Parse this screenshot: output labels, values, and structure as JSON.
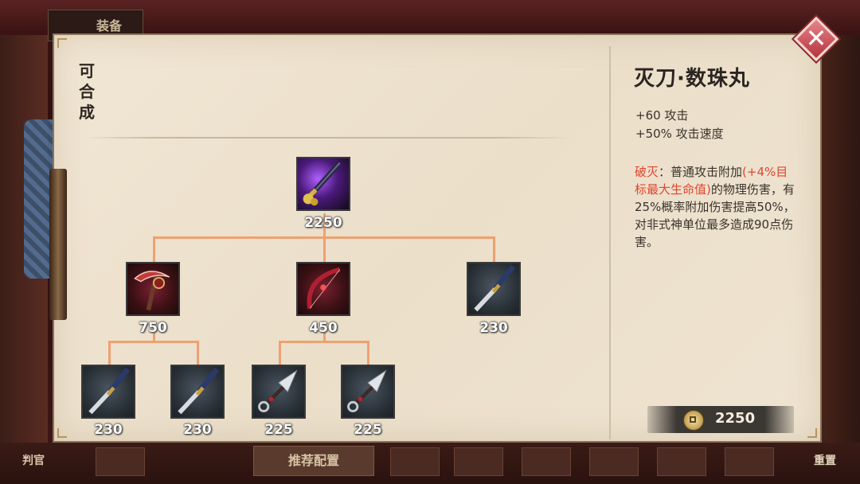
{
  "background": {
    "tab_label": "装备",
    "bottom_left_label": "判官",
    "recommend_label": "推荐配置",
    "reset_label": "重置"
  },
  "panel": {
    "side_title_chars": [
      "可",
      "合",
      "成"
    ]
  },
  "tree": {
    "root": {
      "icon": "purple-katana-icon",
      "price": "2250"
    },
    "level2": [
      {
        "icon": "red-scythe-icon",
        "price": "750"
      },
      {
        "icon": "red-bow-icon",
        "price": "450"
      },
      {
        "icon": "katana-icon",
        "price": "230"
      }
    ],
    "level3": [
      {
        "icon": "katana-icon",
        "price": "230"
      },
      {
        "icon": "katana-icon",
        "price": "230"
      },
      {
        "icon": "kunai-icon",
        "price": "225"
      },
      {
        "icon": "kunai-icon",
        "price": "225"
      }
    ]
  },
  "detail": {
    "name": "灭刀·数珠丸",
    "stats": [
      "+60 攻击",
      "+50% 攻击速度"
    ],
    "skill_name": "破灭",
    "desc_p1": "：普通攻击附加",
    "desc_red": "(+4%目标最大生命值)",
    "desc_p2": "的物理伤害，有25%概率附加伤害提高50%，对非式神单位最多造成90点伤害。",
    "price": "2250"
  },
  "colors": {
    "accent_red": "#e2452e",
    "tree_line": "#f0a070",
    "parchment": "#efe4d1"
  }
}
